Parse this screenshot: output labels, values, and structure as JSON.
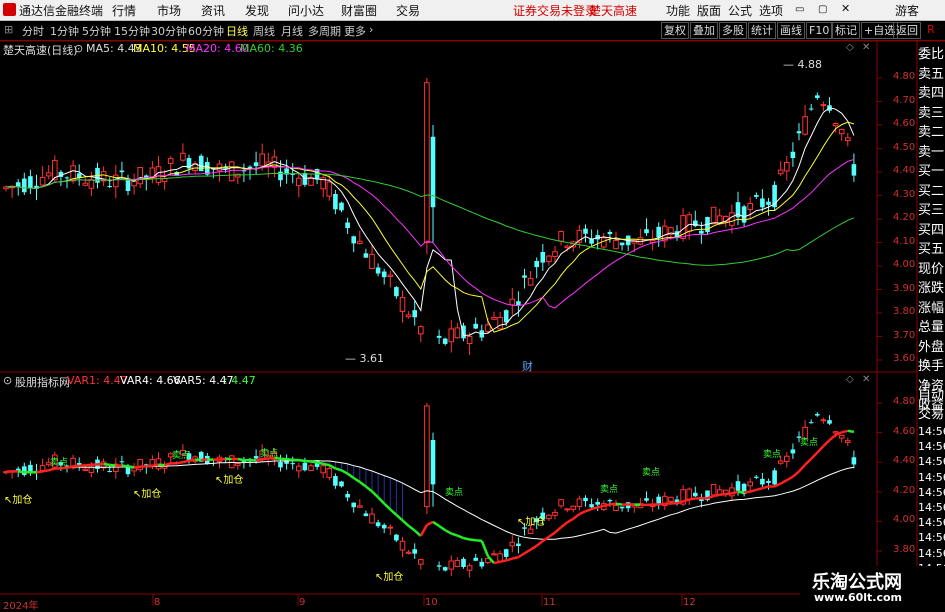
{
  "menubar": {
    "app_title": "通达信金融终端",
    "menus": [
      "行情",
      "市场",
      "资讯",
      "发现",
      "问小达",
      "财富圈",
      "交易"
    ],
    "status_text": "证券交易未登录",
    "stock_title": "楚天高速",
    "right_menus": [
      "功能",
      "版面",
      "公式",
      "选项"
    ],
    "guest_label": "游客",
    "right_tag": "R"
  },
  "toolbar": {
    "periods": [
      "分时",
      "1分钟",
      "5分钟",
      "15分钟",
      "30分钟",
      "60分钟",
      "日线",
      "周线",
      "月线",
      "多周期",
      "更多"
    ],
    "active_period": "日线",
    "right_buttons": [
      "复权",
      "叠加",
      "多股",
      "统计",
      "画线",
      "F10",
      "标记",
      "+自选",
      "返回"
    ]
  },
  "main_chart": {
    "title": "楚天高速(日线)",
    "ma_legends": [
      {
        "text": "MA5: 4.43",
        "color": "#ffffff"
      },
      {
        "text": "MA10: 4.55",
        "color": "#ffff33"
      },
      {
        "text": "MA20: 4.60",
        "color": "#ff33ff"
      },
      {
        "text": "MA60: 4.36",
        "color": "#33cc33"
      }
    ],
    "high_marker": "4.88",
    "low_marker": "3.61",
    "marker_cai": "财",
    "y_ticks": [
      "4.80",
      "4.70",
      "4.60",
      "4.50",
      "4.40",
      "4.30",
      "4.20",
      "4.10",
      "4.00",
      "3.90",
      "3.80",
      "3.70",
      "3.60"
    ]
  },
  "sub_chart": {
    "title": "股朋指标网",
    "legends": [
      {
        "text": "VAR1: 4.47",
        "color": "#ff3333"
      },
      {
        "text": "VAR4: 4.66",
        "color": "#ffffff"
      },
      {
        "text": "VAR5: 4.47",
        "color": "#ffffff"
      },
      {
        "text": ": 4.47",
        "color": "#33ff33"
      }
    ],
    "signal_label": "加仓",
    "sell_label": "卖点",
    "y_ticks": [
      "4.80",
      "4.60",
      "4.40",
      "4.20",
      "4.00",
      "3.80"
    ]
  },
  "side_panel": {
    "items_top": [
      "委比",
      "卖五",
      "卖四",
      "卖三",
      "卖二",
      "卖一",
      "买一",
      "买二",
      "买三",
      "买四",
      "买五",
      "现价",
      "涨跌",
      "涨幅",
      "总量",
      "外盘",
      "换手",
      "净资",
      "收益"
    ],
    "items_bottom": [
      "自动",
      "交易",
      "14:56",
      "14:56",
      "14:56",
      "14:56",
      "14:56",
      "14:56",
      "14:56",
      "14:56",
      "14:56",
      "14:56"
    ]
  },
  "date_axis": {
    "labels": [
      "2024年",
      "8",
      "9",
      "10",
      "11",
      "12"
    ]
  },
  "watermark": {
    "line1": "乐淘公式网",
    "line2": "www.60lt.com"
  }
}
